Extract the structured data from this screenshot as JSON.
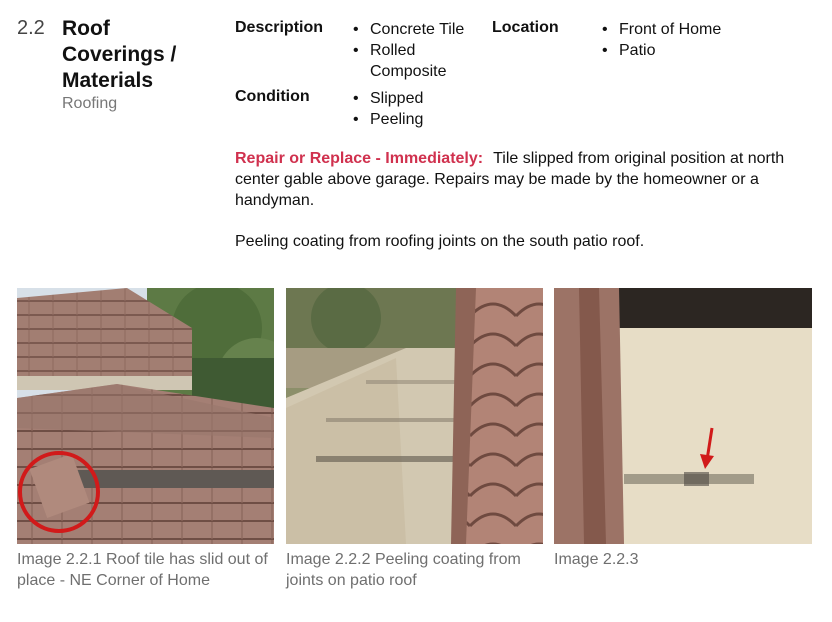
{
  "section": {
    "number": "2.2",
    "title_lines": [
      "Roof",
      "Coverings /",
      "Materials"
    ],
    "subtitle": "Roofing"
  },
  "description": {
    "label": "Description",
    "items": [
      "Concrete Tile",
      "Rolled",
      "Composite"
    ]
  },
  "location": {
    "label": "Location",
    "items": [
      "Front of Home",
      "Patio"
    ]
  },
  "condition": {
    "label": "Condition",
    "items": [
      "Slipped",
      "Peeling"
    ]
  },
  "finding": {
    "severity": "Repair or Replace - Immediately:",
    "text": "Tile slipped from original position at north center gable above garage. Repairs may be made by the homeowner or a handyman."
  },
  "note": "Peeling coating from roofing joints on the south patio roof.",
  "images": [
    {
      "caption": "Image 2.2.1 Roof tile has slid out of place - NE Corner of Home"
    },
    {
      "caption": "Image 2.2.2 Peeling coating from joints on patio roof"
    },
    {
      "caption": "Image 2.2.3"
    }
  ],
  "colors": {
    "severity": "#d0314e",
    "caption": "#6f6f6f",
    "highlight_circle": "#d11a1a"
  }
}
